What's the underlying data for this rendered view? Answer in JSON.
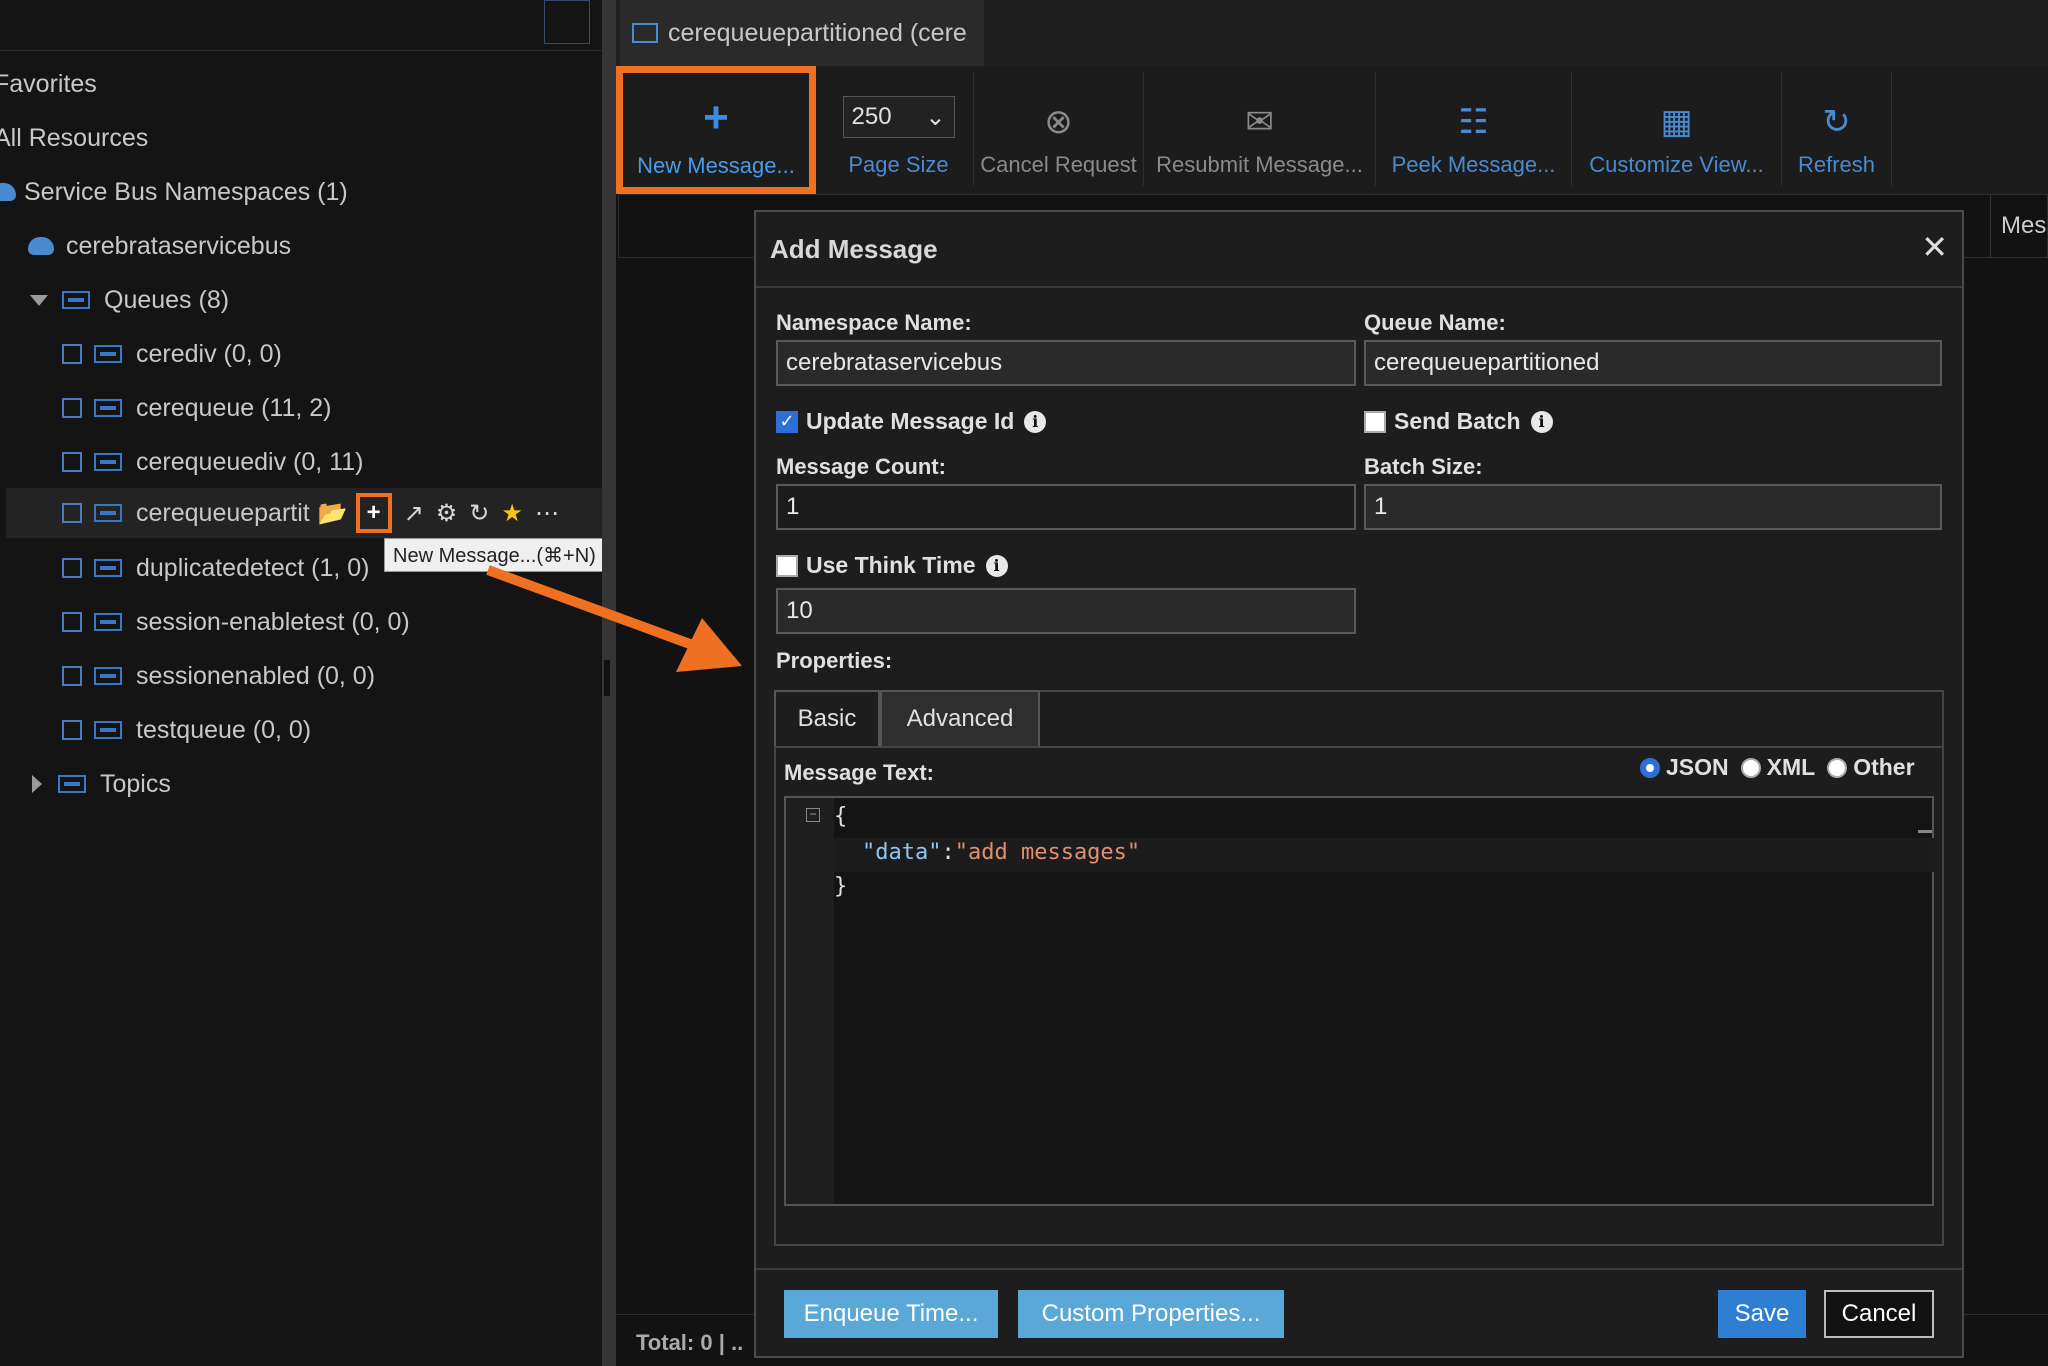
{
  "sidebar": {
    "favorites": "Favorites",
    "all_resources": "All Resources",
    "namespaces": "Service Bus Namespaces (1)",
    "namespace": "cerebrataservicebus",
    "queues": "Queues (8)",
    "queue_items": [
      "cerediv (0, 0)",
      "cerequeue (11, 2)",
      "cerequeuediv (0, 11)",
      "cerequeuepartit",
      "duplicatedetect (1, 0)",
      "session-enabletest (0, 0)",
      "sessionenabled (0, 0)",
      "testqueue (0, 0)"
    ],
    "topics": "Topics",
    "tooltip": "New Message...(⌘+N)"
  },
  "tab": {
    "label": "cerequeuepartitioned (cere"
  },
  "toolbar": {
    "new_message": "New Message...",
    "page_size_value": "250",
    "page_size": "Page Size",
    "cancel_request": "Cancel Request",
    "resubmit": "Resubmit Message...",
    "peek": "Peek Message...",
    "customize": "Customize View...",
    "refresh": "Refresh"
  },
  "grid": {
    "col_header": "Mes",
    "total": "Total: 0 | .."
  },
  "dialog": {
    "title": "Add Message",
    "namespace_label": "Namespace Name:",
    "namespace_value": "cerebrataservicebus",
    "queue_label": "Queue Name:",
    "queue_value": "cerequeuepartitioned",
    "update_id_label": "Update Message Id",
    "update_id_checked": true,
    "send_batch_label": "Send Batch",
    "send_batch_checked": false,
    "count_label": "Message Count:",
    "count_value": "1",
    "batch_size_label": "Batch Size:",
    "batch_size_value": "1",
    "think_time_label": "Use Think Time",
    "think_time_checked": false,
    "think_time_value": "10",
    "properties_label": "Properties:",
    "tab_basic": "Basic",
    "tab_advanced": "Advanced",
    "message_text_label": "Message Text:",
    "format_json": "JSON",
    "format_xml": "XML",
    "format_other": "Other",
    "selected_format": "JSON",
    "code": {
      "open": "{",
      "key": "\"data\"",
      "colon": ":",
      "value": "\"add messages\"",
      "close": "}"
    },
    "enqueue_time": "Enqueue Time...",
    "custom_properties": "Custom Properties...",
    "save": "Save",
    "cancel": "Cancel"
  },
  "colors": {
    "accent_orange": "#f07022",
    "blue": "#2e7fd4"
  }
}
